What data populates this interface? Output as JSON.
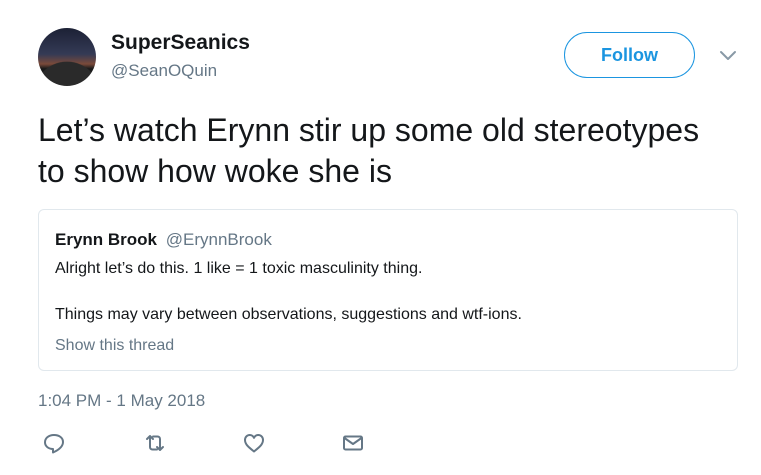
{
  "author": {
    "display_name": "SuperSeanics",
    "handle": "@SeanOQuin",
    "avatar_icon": "avatar-night-sky"
  },
  "follow_label": "Follow",
  "tweet_text": "Let’s watch Erynn stir up some old stereotypes to show how woke she is",
  "quoted_tweet": {
    "display_name": "Erynn Brook",
    "handle": "@ErynnBrook",
    "line1": "Alright let’s do this. 1 like = 1 toxic masculinity thing.",
    "line2": "Things may vary between observations, suggestions and wtf-ions.",
    "show_thread": "Show this thread"
  },
  "timestamp": "1:04 PM - 1 May 2018",
  "actions": [
    "reply-icon",
    "retweet-icon",
    "like-icon",
    "message-icon"
  ],
  "colors": {
    "accent": "#1b95e0",
    "muted": "#657786",
    "text": "#14171a",
    "border": "#e1e8ed"
  }
}
